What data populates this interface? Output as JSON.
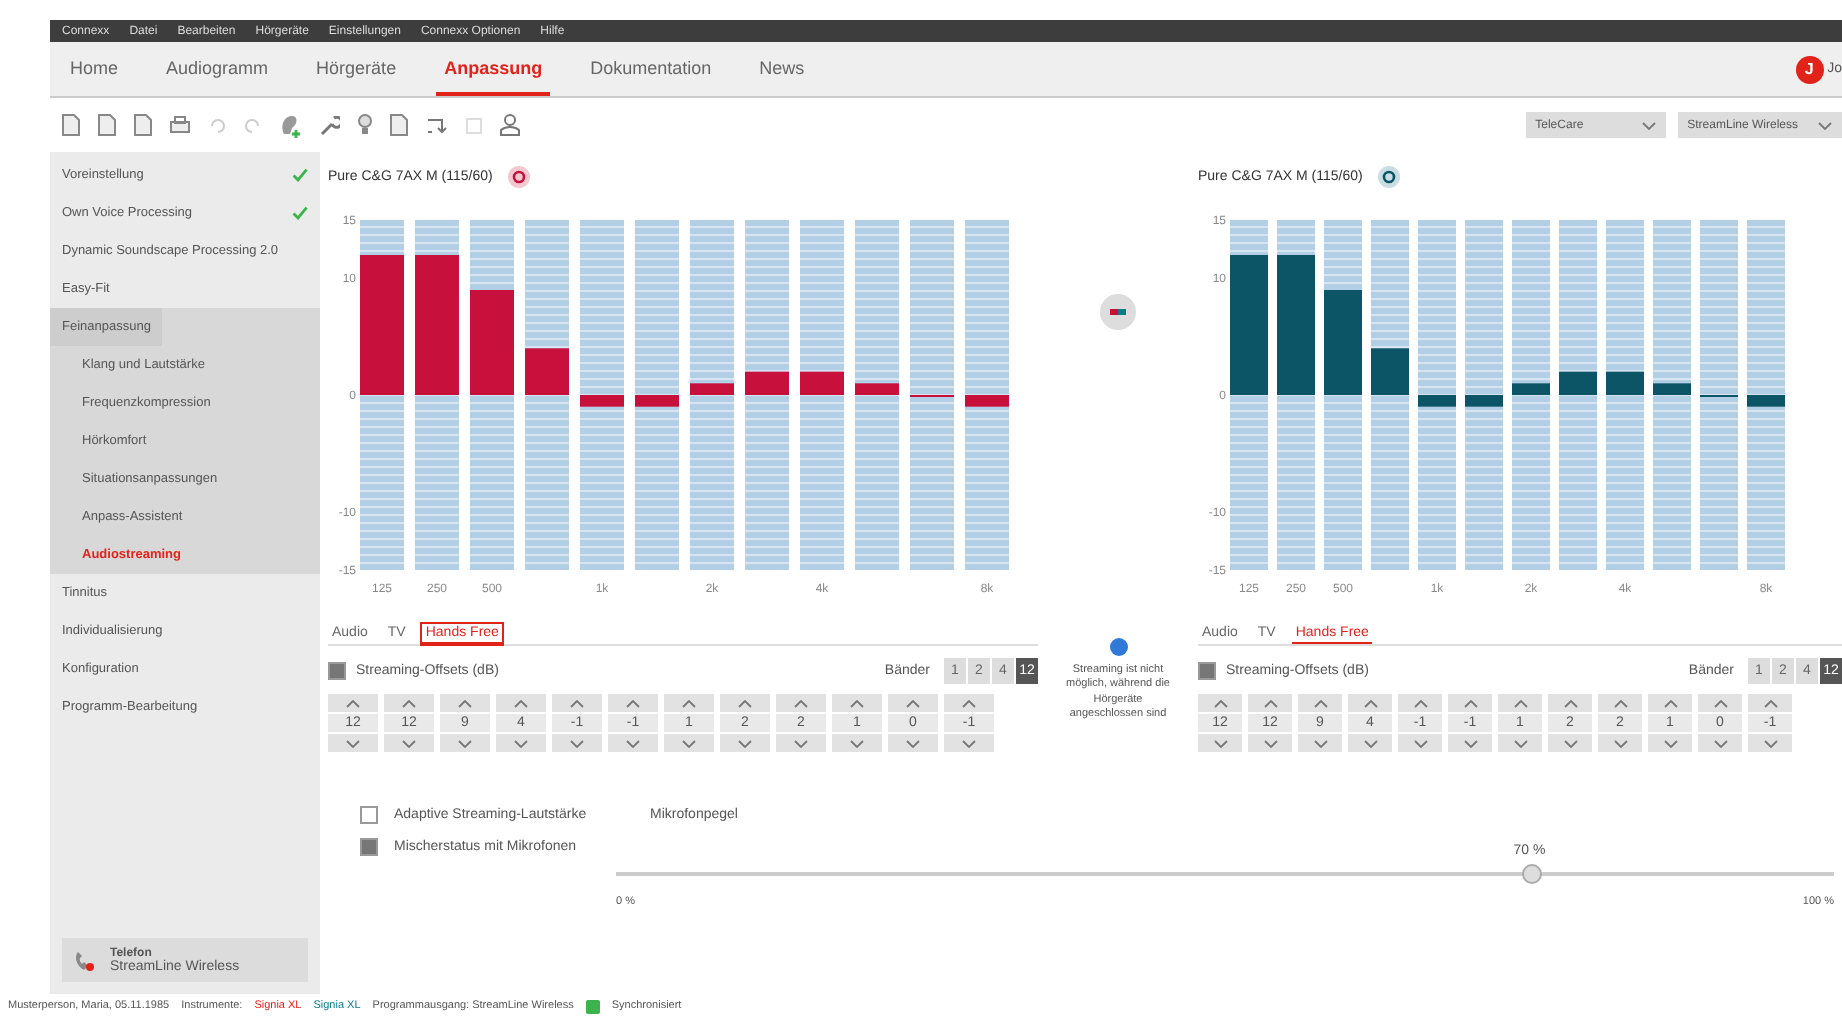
{
  "menu_bar": {
    "items": [
      "Connexx",
      "Datei",
      "Bearbeiten",
      "Hörgeräte",
      "Einstellungen",
      "Connexx Optionen",
      "Hilfe"
    ]
  },
  "tabs": [
    {
      "label": "Home",
      "selected": false
    },
    {
      "label": "Audiogramm",
      "selected": false
    },
    {
      "label": "Hörgeräte",
      "selected": false
    },
    {
      "label": "Anpassung",
      "selected": true
    },
    {
      "label": "Dokumentation",
      "selected": false
    },
    {
      "label": "News",
      "selected": false
    }
  ],
  "user": {
    "initial": "J",
    "name": "Jo"
  },
  "toolbar": {
    "dropdowns": [
      "TeleCare",
      "StreamLine Wireless"
    ]
  },
  "sidebar": {
    "items": [
      {
        "label": "Voreinstellung",
        "done": true,
        "selected": false
      },
      {
        "label": "Own Voice Processing",
        "done": true,
        "selected": false
      },
      {
        "label": "Dynamic Soundscape Processing 2.0",
        "done": false,
        "selected": false
      },
      {
        "label": "Easy-Fit",
        "done": false,
        "selected": false
      },
      {
        "label": "Feinanpassung",
        "done": false,
        "selected": false,
        "expanded": true,
        "children": [
          {
            "label": "Klang und Lautstärke",
            "selected": false
          },
          {
            "label": "Frequenzkompression",
            "selected": false
          },
          {
            "label": "Hörkomfort",
            "selected": false
          },
          {
            "label": "Situationsanpassungen",
            "selected": false
          },
          {
            "label": "Anpass-Assistent",
            "selected": false
          },
          {
            "label": "Audiostreaming",
            "selected": true
          }
        ]
      },
      {
        "label": "Tinnitus",
        "done": false,
        "selected": false
      },
      {
        "label": "Individualisierung",
        "done": false,
        "selected": false
      },
      {
        "label": "Konfiguration",
        "done": false,
        "selected": false
      },
      {
        "label": "Programm-Bearbeitung",
        "done": false,
        "selected": false
      }
    ],
    "program": {
      "title": "Telefon",
      "subtitle": "StreamLine Wireless"
    }
  },
  "sides": [
    {
      "title": "Pure C&G 7AX M (115/60)",
      "color": "#c8103c",
      "chart_data": {
        "type": "bar",
        "ylim": [
          -15,
          15
        ],
        "yticks": [
          15,
          10,
          0,
          -10,
          -15
        ],
        "categories": [
          "125",
          "250",
          "500",
          null,
          "1k",
          null,
          "2k",
          null,
          "4k",
          null,
          null,
          "8k"
        ],
        "values": [
          12,
          12,
          9,
          4,
          -1,
          -1,
          1,
          2,
          2,
          1,
          0,
          -1
        ]
      },
      "stream_tabs": [
        {
          "label": "Audio",
          "selected": false,
          "highlighted": false
        },
        {
          "label": "TV",
          "selected": false,
          "highlighted": false
        },
        {
          "label": "Hands Free",
          "selected": true,
          "highlighted": true
        }
      ],
      "offsets_label": "Streaming-Offsets (dB)",
      "offsets_checked": true,
      "bands_label": "Bänder",
      "bands": [
        {
          "label": "1",
          "selected": false
        },
        {
          "label": "2",
          "selected": false
        },
        {
          "label": "4",
          "selected": false
        },
        {
          "label": "12",
          "selected": true
        }
      ],
      "offsets": [
        "12",
        "12",
        "9",
        "4",
        "-1",
        "-1",
        "1",
        "2",
        "2",
        "1",
        "0",
        "-1"
      ]
    },
    {
      "title": "Pure C&G 7AX M (115/60)",
      "color": "#0b5566",
      "chart_data": {
        "type": "bar",
        "ylim": [
          -15,
          15
        ],
        "yticks": [
          15,
          10,
          0,
          -10,
          -15
        ],
        "categories": [
          "125",
          "250",
          "500",
          null,
          "1k",
          null,
          "2k",
          null,
          "4k",
          null,
          null,
          "8k"
        ],
        "values": [
          12,
          12,
          9,
          4,
          -1,
          -1,
          1,
          2,
          2,
          1,
          0,
          -1
        ]
      },
      "stream_tabs": [
        {
          "label": "Audio",
          "selected": false,
          "highlighted": false
        },
        {
          "label": "TV",
          "selected": false,
          "highlighted": false
        },
        {
          "label": "Hands Free",
          "selected": true,
          "highlighted": false
        }
      ],
      "offsets_label": "Streaming-Offsets (dB)",
      "offsets_checked": true,
      "bands_label": "Bänder",
      "bands": [
        {
          "label": "1",
          "selected": false
        },
        {
          "label": "2",
          "selected": false
        },
        {
          "label": "4",
          "selected": false
        },
        {
          "label": "12",
          "selected": true
        }
      ],
      "offsets": [
        "12",
        "12",
        "9",
        "4",
        "-1",
        "-1",
        "1",
        "2",
        "2",
        "1",
        "0",
        "-1"
      ]
    }
  ],
  "center_note": "Streaming ist nicht möglich, während die Hörgeräte angeschlossen sind",
  "options": [
    {
      "label": "Adaptive Streaming-Lautstärke",
      "checked": false,
      "extra": "Mikrofonpegel"
    },
    {
      "label": "Mischerstatus mit Mikrofonen",
      "checked": true
    }
  ],
  "mic_slider": {
    "level": 0.75,
    "reading": "70 %",
    "min_label": "0 %",
    "max_label": "100 %"
  },
  "status_bar": {
    "patient": "Musterperson, Maria, 05.11.1985",
    "instruments_label": "Instrumente:",
    "left_device": "Signia XL",
    "right_device": "Signia XL",
    "program_output": "Programmausgang: StreamLine Wireless",
    "sync": "Synchronisiert"
  }
}
